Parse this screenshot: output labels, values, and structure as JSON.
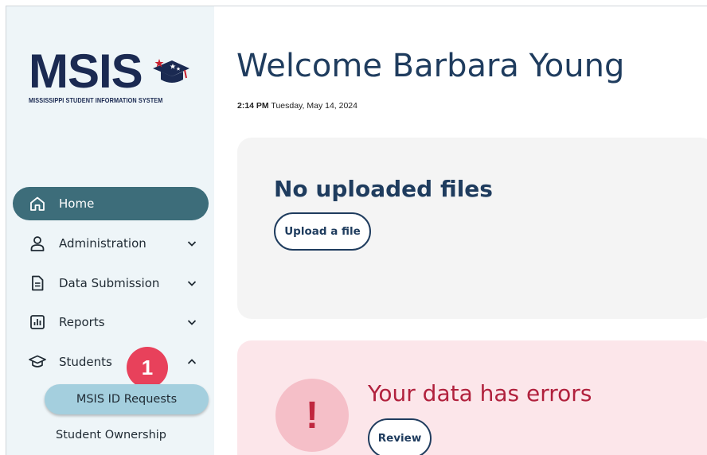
{
  "app": {
    "logo_text": "MSIS",
    "logo_subtitle": "MISSISSIPPI STUDENT INFORMATION SYSTEM"
  },
  "sidebar": {
    "items": [
      {
        "label": "Home",
        "icon": "home-icon",
        "active": true
      },
      {
        "label": "Administration",
        "icon": "user-icon",
        "expanded": false
      },
      {
        "label": "Data Submission",
        "icon": "document-icon",
        "expanded": false
      },
      {
        "label": "Reports",
        "icon": "chart-icon",
        "expanded": false
      },
      {
        "label": "Students",
        "icon": "graduation-cap-icon",
        "expanded": true
      }
    ],
    "sub_items": [
      {
        "label": "MSIS ID Requests",
        "active": true
      },
      {
        "label": "Student Ownership",
        "active": false
      }
    ],
    "badge": "1"
  },
  "main": {
    "welcome": "Welcome Barbara Young",
    "time": "2:14 PM",
    "date": "Tuesday, May 14, 2024",
    "files_card": {
      "title": "No uploaded files",
      "button": "Upload a file"
    },
    "errors_card": {
      "icon": "!",
      "title": "Your data has errors",
      "button": "Review"
    }
  },
  "colors": {
    "sidebar_bg": "#eef5f8",
    "home_active": "#3d6d7a",
    "sub_active": "#a4cfde",
    "badge": "#e8415b",
    "navy": "#1f3c5e",
    "error_red": "#b1213d",
    "error_bg": "#fce6ea"
  }
}
